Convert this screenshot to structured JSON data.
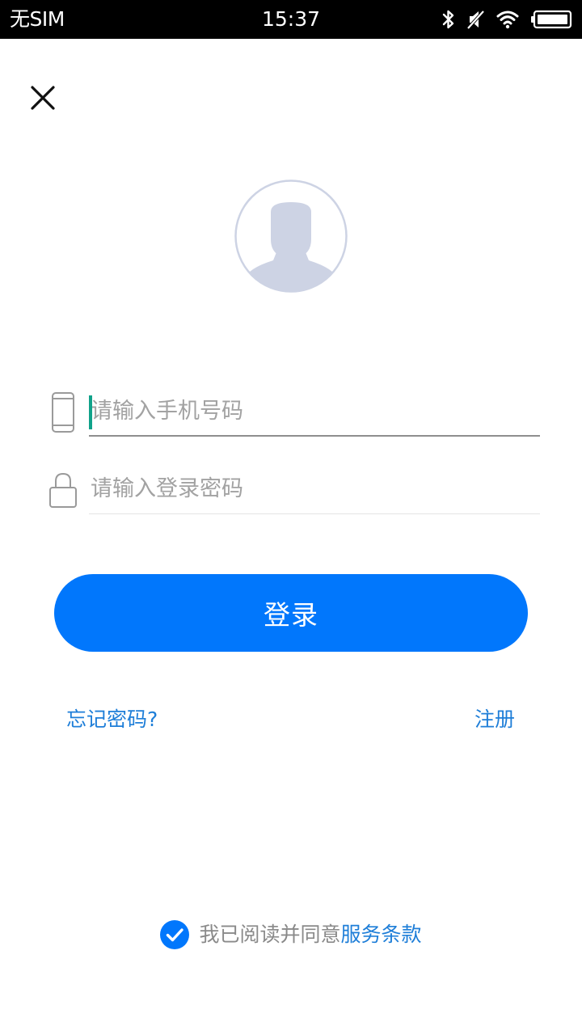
{
  "status_bar": {
    "carrier": "无SIM",
    "time": "15:37",
    "icons": [
      "bluetooth-icon",
      "muted-icon",
      "wifi-icon",
      "battery-icon"
    ]
  },
  "close": {
    "icon": "close-icon"
  },
  "avatar": {
    "icon": "default-user-avatar"
  },
  "phone_field": {
    "icon": "mobile-phone-icon",
    "placeholder": "请输入手机号码",
    "value": ""
  },
  "password_field": {
    "icon": "lock-icon",
    "placeholder": "请输入登录密码",
    "value": ""
  },
  "login_button": {
    "label": "登录"
  },
  "links": {
    "forgot_password": "忘记密码?",
    "register": "注册"
  },
  "agreement": {
    "checked": true,
    "text": "我已阅读并同意",
    "terms_link": "服务条款"
  },
  "colors": {
    "primary": "#0177fc",
    "link": "#1e7ed8",
    "avatar": "#cdd3e4",
    "caret": "#10a28a",
    "placeholder": "#a2a2a2"
  }
}
